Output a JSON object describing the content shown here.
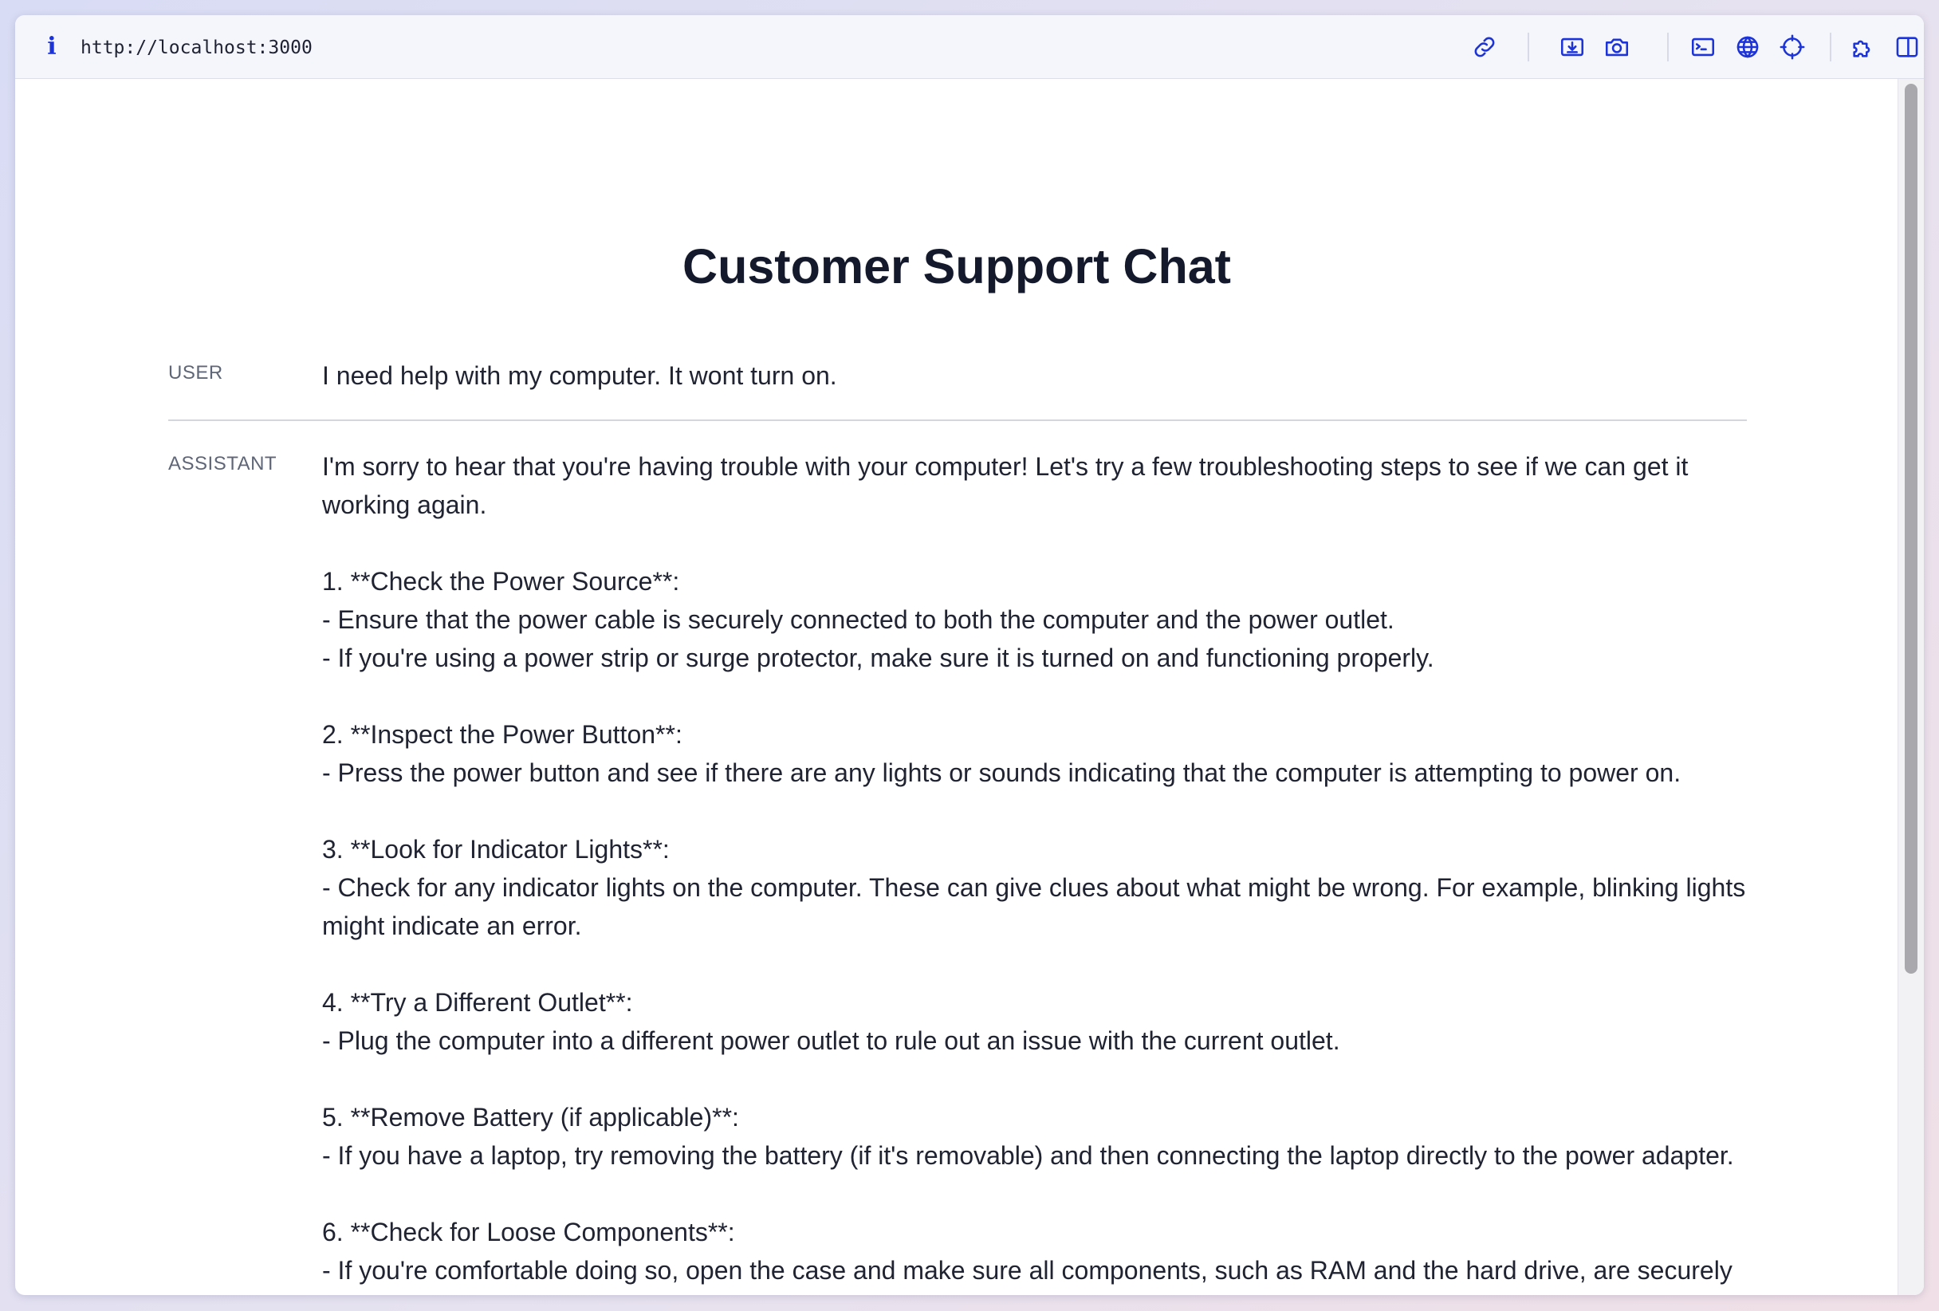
{
  "browser": {
    "url": "http://localhost:3000",
    "info_icon": "info-icon",
    "toolbar_icons": [
      "link-icon",
      "download-capture-icon",
      "camera-icon",
      "terminal-icon",
      "globe-icon",
      "crosshair-icon",
      "extensions-puzzle-icon",
      "split-view-icon"
    ],
    "accent_color": "#1c33d8"
  },
  "page": {
    "title": "Customer Support Chat"
  },
  "messages": [
    {
      "role": "USER",
      "text": "I need help with my computer. It wont turn on."
    },
    {
      "role": "ASSISTANT",
      "text": "I'm sorry to hear that you're having trouble with your computer! Let's try a few troubleshooting steps to see if we can get it working again.\n\n1. **Check the Power Source**:\n- Ensure that the power cable is securely connected to both the computer and the power outlet.\n- If you're using a power strip or surge protector, make sure it is turned on and functioning properly.\n\n2. **Inspect the Power Button**:\n- Press the power button and see if there are any lights or sounds indicating that the computer is attempting to power on.\n\n3. **Look for Indicator Lights**:\n- Check for any indicator lights on the computer. These can give clues about what might be wrong. For example, blinking lights might indicate an error.\n\n4. **Try a Different Outlet**:\n- Plug the computer into a different power outlet to rule out an issue with the current outlet.\n\n5. **Remove Battery (if applicable)**:\n- If you have a laptop, try removing the battery (if it's removable) and then connecting the laptop directly to the power adapter.\n\n6. **Check for Loose Components**:\n- If you're comfortable doing so, open the case and make sure all components, such as RAM and the hard drive, are securely connected."
    }
  ]
}
